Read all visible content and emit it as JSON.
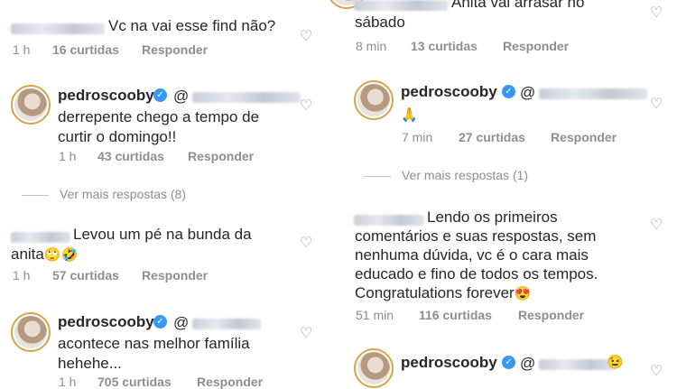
{
  "left": {
    "c1": {
      "text": "Vc na vai esse find  não?",
      "time": "1 h",
      "likes": "16 curtidas",
      "reply": "Responder"
    },
    "r1": {
      "user": "pedroscooby",
      "line1": "derrepente chego a tempo de",
      "line2": "curtir o domingo!!",
      "time": "1 h",
      "likes": "43 curtidas",
      "reply": "Responder"
    },
    "more": "Ver mais respostas (8)",
    "c2": {
      "line1": "Levou um pé na bunda da",
      "line2": "anita",
      "emoji": "🙄🤣",
      "time": "1 h",
      "likes": "57 curtidas",
      "reply": "Responder"
    },
    "r2": {
      "user": "pedroscooby",
      "line1": "acontece nas melhor família",
      "line2": "hehehe...",
      "time": "1 h",
      "likes": "705 curtidas",
      "reply": "Responder"
    }
  },
  "right": {
    "c0": {
      "line1": "Anita vai arrasar no",
      "line2": "sábado",
      "time": "8 min",
      "likes": "13 curtidas",
      "reply": "Responder"
    },
    "r1": {
      "user": "pedroscooby",
      "emoji": "🙏",
      "time": "7 min",
      "likes": "27 curtidas",
      "reply": "Responder"
    },
    "more": "Ver mais respostas (1)",
    "c1": {
      "line1": "Lendo os primeiros",
      "line2": "comentários e suas respostas, sem",
      "line3": "nenhuma dúvida, vc é o cara mais",
      "line4": "educado e fino de todos os tempos.",
      "line5": "Congratulations forever",
      "emoji": "😍",
      "time": "51 min",
      "likes": "116 curtidas",
      "reply": "Responder"
    },
    "r2": {
      "user": "pedroscooby",
      "emoji": "😉"
    }
  },
  "icons": {
    "heart": "♡",
    "verified": "✓"
  }
}
